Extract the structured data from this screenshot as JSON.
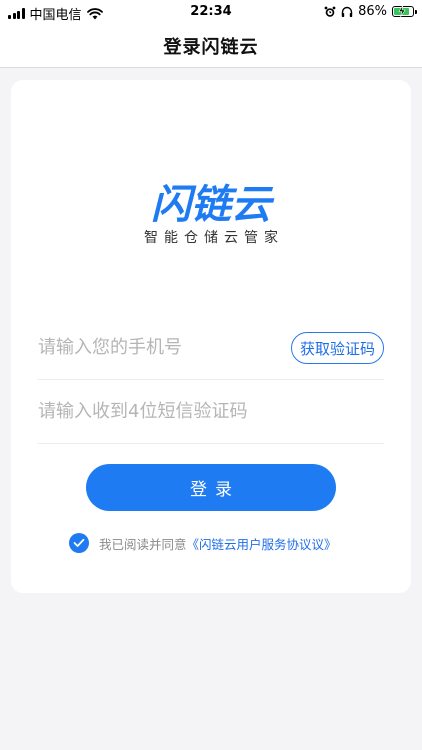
{
  "status_bar": {
    "carrier": "中国电信",
    "time": "22:34",
    "battery_percent": "86%",
    "battery_level": 0.86,
    "icons": [
      "signal-icon",
      "wifi-icon",
      "alarm-icon",
      "headphones-icon",
      "battery-icon",
      "charging-bolt-icon"
    ]
  },
  "nav": {
    "title": "登录闪链云"
  },
  "logo": {
    "name": "闪链云",
    "tagline": "智能仓储云管家",
    "brand_color": "#1e7bf2"
  },
  "form": {
    "phone_placeholder": "请输入您的手机号",
    "phone_value": "",
    "code_placeholder": "请输入收到4位短信验证码",
    "code_value": "",
    "get_code_label": "获取验证码",
    "login_label": "登录"
  },
  "agreement": {
    "checked": true,
    "prefix": "我已阅读并同意",
    "link": "《闪链云用户服务协议议》"
  },
  "colors": {
    "accent": "#1e7bf2",
    "background": "#f4f4f6",
    "placeholder": "#b5b5b5",
    "battery_green": "#34c759"
  }
}
